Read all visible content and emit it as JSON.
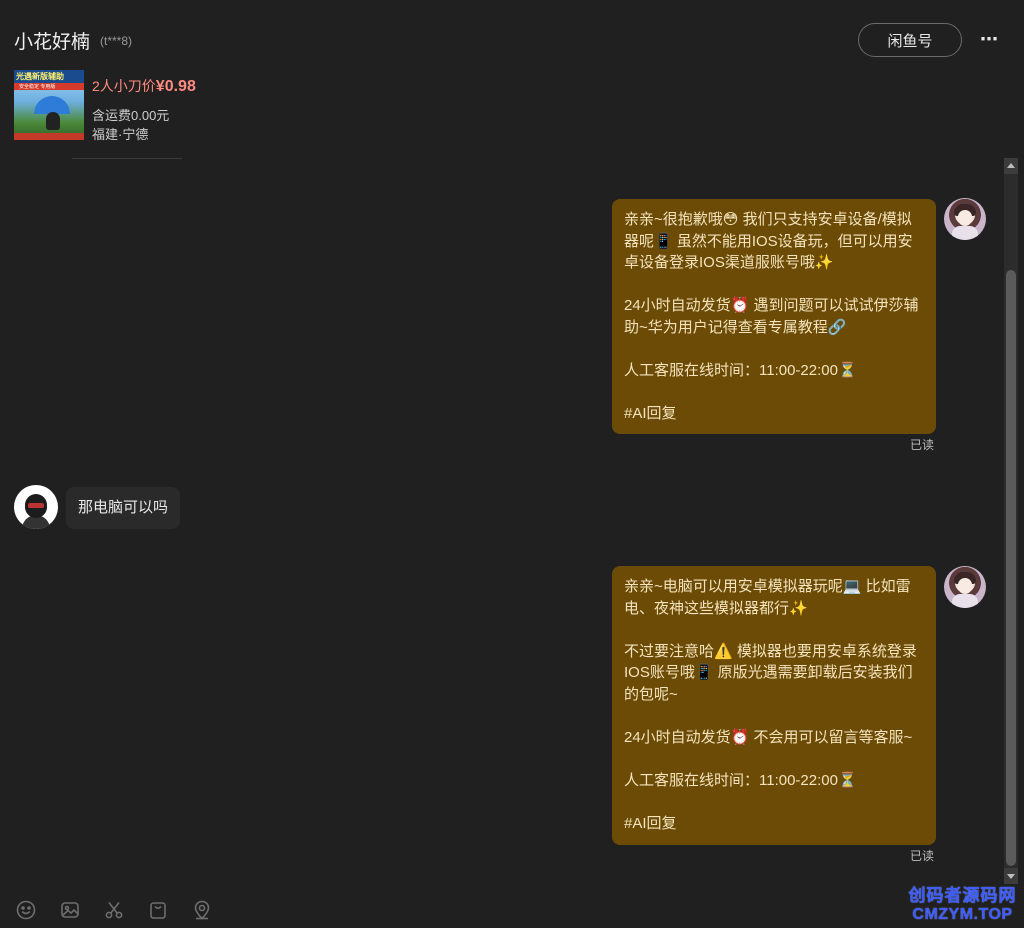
{
  "header": {
    "title": "小花好楠",
    "user_id": "(t***8)",
    "xianyu_button_label": "闲鱼号",
    "more_icon": "ellipsis-icon"
  },
  "product": {
    "thumbnail_caption": "光遇新版辅助",
    "thumbnail_subcaption": "安全稳定 专用版",
    "price_prefix": "2人小刀价",
    "price": "¥0.98",
    "shipping": "含运费0.00元",
    "location": "福建·宁德"
  },
  "messages": [
    {
      "sender": "me",
      "paragraphs": [
        "亲亲~很抱歉哦😳 我们只支持安卓设备/模拟器呢📱 虽然不能用IOS设备玩，但可以用安卓设备登录IOS渠道服账号哦✨",
        "24小时自动发货⏰ 遇到问题可以试试伊莎辅助~华为用户记得查看专属教程🔗",
        "人工客服在线时间：11:00-22:00⏳",
        "#AI回复"
      ],
      "status": "已读"
    },
    {
      "sender": "them",
      "text": "那电脑可以吗"
    },
    {
      "sender": "me",
      "paragraphs": [
        "亲亲~电脑可以用安卓模拟器玩呢💻 比如雷电、夜神这些模拟器都行✨",
        "不过要注意哈⚠️ 模拟器也要用安卓系统登录IOS账号哦📱 原版光遇需要卸载后安装我们的包呢~",
        "24小时自动发货⏰ 不会用可以留言等客服~",
        "人工客服在线时间：11:00-22:00⏳",
        "#AI回复"
      ],
      "status": "已读"
    }
  ],
  "toolbar": {
    "icons": [
      "emoji-icon",
      "image-icon",
      "scissors-icon",
      "bag-icon",
      "location-icon"
    ]
  },
  "watermark": {
    "line1": "创码者源码网",
    "line2": "CMZYM.TOP"
  },
  "colors": {
    "background": "#202020",
    "my_bubble": "#6b4b05",
    "their_bubble": "#2a2a2a",
    "price": "#ff8a80",
    "watermark": "#3d5cff"
  }
}
